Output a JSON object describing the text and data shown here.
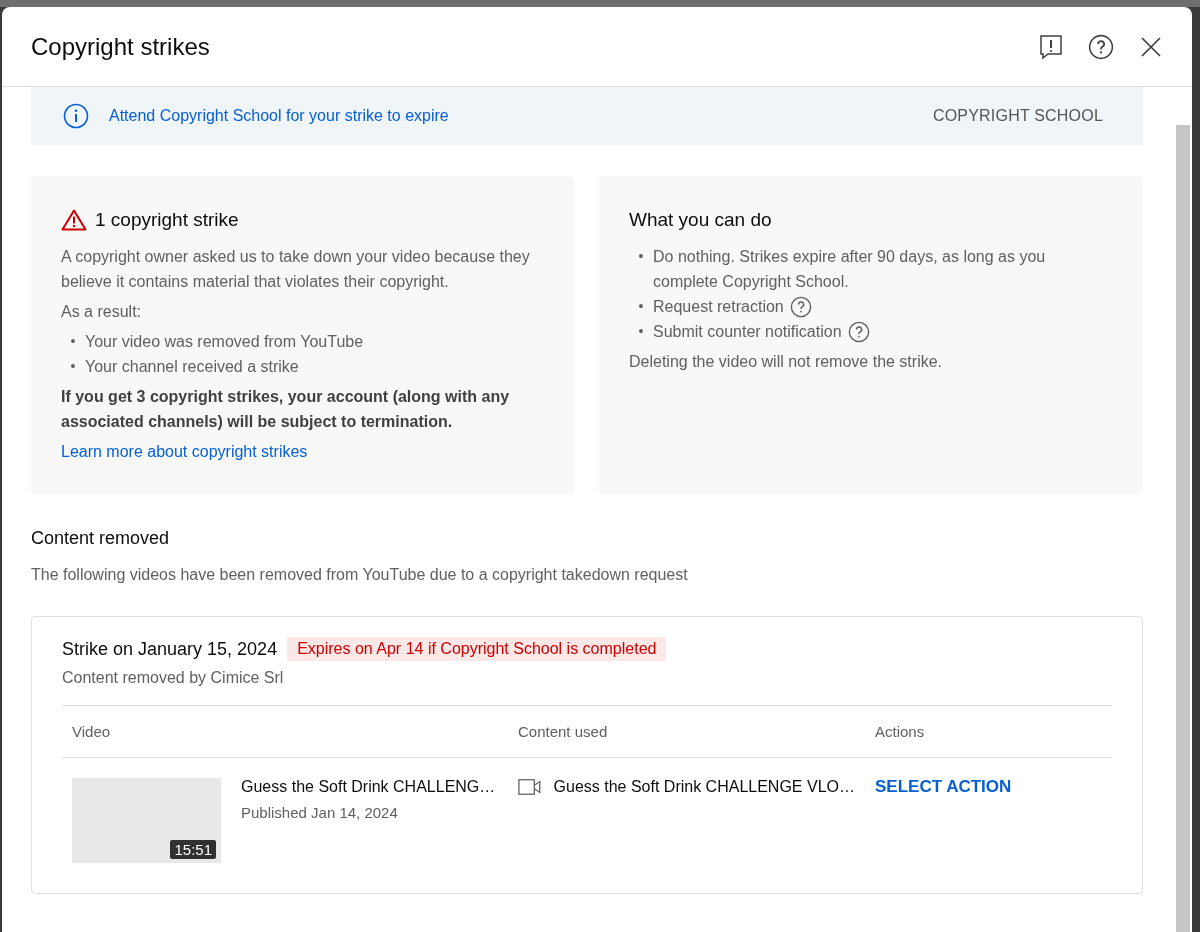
{
  "dialog": {
    "title": "Copyright strikes"
  },
  "banner": {
    "text": "Attend Copyright School for your strike to expire",
    "button": "COPYRIGHT SCHOOL"
  },
  "strike_card": {
    "title": "1 copyright strike",
    "description": "A copyright owner asked us to take down your video because they believe it contains material that violates their copyright.",
    "result_label": "As a result:",
    "results": [
      {
        "bullet": "•",
        "text": "Your video was removed from YouTube"
      },
      {
        "bullet": "•",
        "text": "Your channel received a strike"
      }
    ],
    "warning": "If you get 3 copyright strikes, your account (along with any associated channels) will be subject to termination.",
    "link": "Learn more about copyright strikes"
  },
  "options_card": {
    "title": "What you can do",
    "options": [
      {
        "bullet": "•",
        "text": "Do nothing. Strikes expire after 90 days, as long as you complete Copyright School.",
        "help": false
      },
      {
        "bullet": "•",
        "text": "Request retraction",
        "help": true
      },
      {
        "bullet": "•",
        "text": "Submit counter notification",
        "help": true
      }
    ],
    "note": "Deleting the video will not remove the strike."
  },
  "content_removed": {
    "title": "Content removed",
    "description": "The following videos have been removed from YouTube due to a copyright takedown request"
  },
  "strike": {
    "title": "Strike on January 15, 2024",
    "expiry_badge": "Expires on Apr 14 if Copyright School is completed",
    "removed_by": "Content removed by Cimice Srl",
    "columns": [
      "Video",
      "Content used",
      "Actions"
    ],
    "rows": [
      {
        "video_title": "Guess the Soft Drink CHALLENG…",
        "published": "Published Jan 14, 2024",
        "duration": "15:51",
        "content_used": "Guess the Soft Drink CHALLENGE VLO…",
        "action": "SELECT ACTION"
      }
    ]
  }
}
